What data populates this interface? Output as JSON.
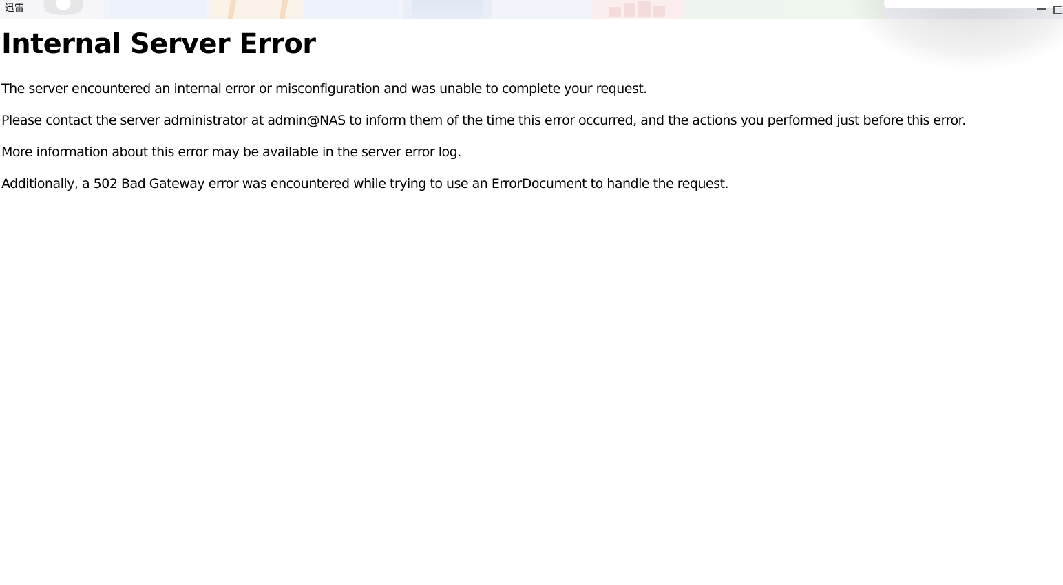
{
  "window": {
    "title": "迅雷"
  },
  "error_page": {
    "heading": "Internal Server Error",
    "paragraphs": [
      "The server encountered an internal error or misconfiguration and was unable to complete your request.",
      "Please contact the server administrator at admin@NAS to inform them of the time this error occurred, and the actions you performed just before this error.",
      "More information about this error may be available in the server error log.",
      "Additionally, a 502 Bad Gateway error was encountered while trying to use an ErrorDocument to handle the request."
    ]
  },
  "icons": {
    "minimize": "minimize-icon",
    "restore": "restore-icon"
  }
}
